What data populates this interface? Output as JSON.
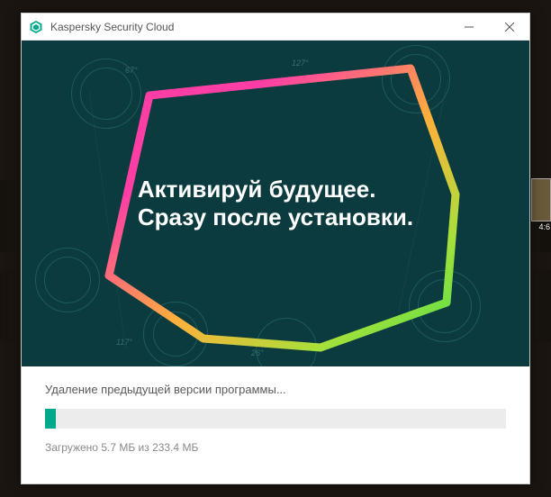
{
  "titlebar": {
    "title": "Kaspersky Security Cloud"
  },
  "hero": {
    "line1": "Активируй будущее.",
    "line2": "Сразу после установки.",
    "angles": {
      "a67": "67°",
      "a127": "127°",
      "a117": "117°",
      "a26": "26°"
    }
  },
  "footer": {
    "status": "Удаление предыдущей версии программы...",
    "download_prefix": "Загружено ",
    "downloaded": "5.7 МБ",
    "of": " из ",
    "total": "233.4 МБ",
    "progress_percent": 2.4
  },
  "desktop": {
    "thumb_label": "4:6"
  },
  "colors": {
    "accent": "#00a88e",
    "hero_bg": "#0b3b3f"
  }
}
